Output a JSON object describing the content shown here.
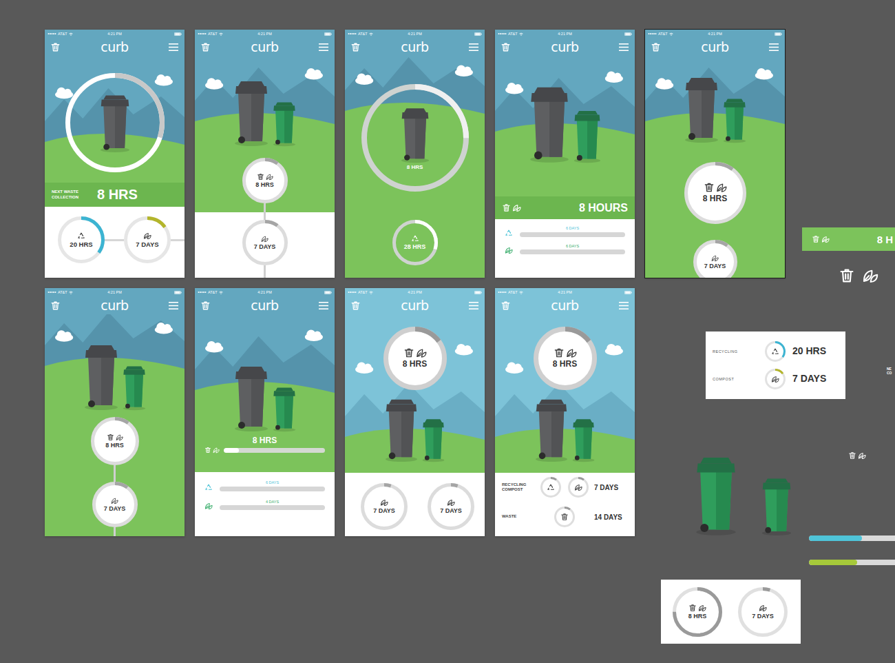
{
  "status_bar": {
    "carrier": "AT&T",
    "time": "4:21 PM"
  },
  "app_title": "curb",
  "screens": [
    {
      "kind": "hero",
      "selected": false,
      "ring_level": 0.3,
      "band": {
        "label": "NEXT WASTE COLLECTION",
        "reading": "8 HRS"
      },
      "gauges": [
        {
          "kind": "recycling",
          "reading": "20 HRS",
          "level": 0.35,
          "color": "#3cb4d2"
        },
        {
          "kind": "compost",
          "reading": "7 DAYS",
          "level": 0.15,
          "color": "#b3b52b"
        }
      ]
    },
    {
      "kind": "timeline-split",
      "selected": false,
      "connected": true,
      "nodes": [
        {
          "kind": "both",
          "reading": "8 HRS",
          "level": 0.1
        },
        {
          "kind": "compost",
          "reading": "7 DAYS",
          "level": 0.1
        }
      ]
    },
    {
      "kind": "ring-center",
      "selected": false,
      "ring": {
        "reading": "8 HRS",
        "level": 0.25
      },
      "next": {
        "kind": "recycling",
        "reading": "28 HRS",
        "level": 0.3
      }
    },
    {
      "kind": "bar-list",
      "selected": false,
      "band": {
        "kind": "both",
        "reading": "8 HOURS"
      },
      "bars": [
        {
          "kind": "recycling",
          "label": "6 DAYS",
          "level": 0.5,
          "color": "#4fc4d8"
        },
        {
          "kind": "compost",
          "label": "6 DAYS",
          "level": 0.45,
          "color": "#3aae6c"
        }
      ]
    },
    {
      "kind": "stack",
      "selected": true,
      "connected": false,
      "nodes": [
        {
          "kind": "both",
          "reading": "8 HRS",
          "level": 0.1
        },
        {
          "kind": "compost",
          "reading": "7 DAYS",
          "level": 0.1
        }
      ]
    },
    {
      "kind": "timeline",
      "selected": false,
      "connected": true,
      "nodes": [
        {
          "kind": "both",
          "reading": "8 HRS",
          "level": 0.1
        },
        {
          "kind": "compost",
          "reading": "7 DAYS",
          "level": 0.1
        }
      ]
    },
    {
      "kind": "bar-split",
      "selected": false,
      "main": {
        "kind": "both",
        "reading": "8 HRS",
        "level": 0.15
      },
      "bars": [
        {
          "kind": "recycling",
          "label": "6 DAYS",
          "level": 0.45,
          "color": "#4fc4d8"
        },
        {
          "kind": "compost",
          "label": "4 DAYS",
          "level": 0.45,
          "color": "#3aae6c"
        }
      ]
    },
    {
      "kind": "top-ring-circles",
      "selected": false,
      "ring": {
        "kind": "both",
        "reading": "8 HRS",
        "level": 0.15
      },
      "circles": [
        {
          "kind": "compost",
          "reading": "7 DAYS",
          "level": 0.05
        },
        {
          "kind": "compost",
          "reading": "7 DAYS",
          "level": 0.05
        }
      ]
    },
    {
      "kind": "top-ring-rows",
      "selected": false,
      "ring": {
        "kind": "both",
        "reading": "8 HRS",
        "level": 0.15
      },
      "rows": [
        {
          "label": "RECYCLING COMPOST",
          "icons": [
            {
              "kind": "recycling",
              "level": 0.1
            },
            {
              "kind": "compost",
              "level": 0.1
            }
          ],
          "reading": "7 DAYS"
        },
        {
          "label": "WASTE",
          "icons": [
            {
              "kind": "waste",
              "level": 0.1
            }
          ],
          "reading": "14 DAYS"
        }
      ]
    }
  ],
  "palette": {
    "band": {
      "kind": "both",
      "reading": "8 H"
    },
    "card": [
      {
        "label": "RECYCLING",
        "kind": "recycling",
        "reading": "20 HRS",
        "level": 0.35,
        "color": "#3cb4d2"
      },
      {
        "label": "COMPOST",
        "kind": "compost",
        "reading": "7 DAYS",
        "level": 0.15,
        "color": "#b3b52b"
      }
    ],
    "edge_label": [
      "NE",
      "CO"
    ],
    "bars": [
      {
        "level": 0.55,
        "color": "#4fc4d8"
      },
      {
        "level": 0.5,
        "color": "#a6c93a"
      }
    ],
    "gauges": [
      {
        "kind": "both",
        "reading": "8 HRS",
        "level": 0.75
      },
      {
        "kind": "compost",
        "reading": "7 DAYS",
        "level": 0.05
      }
    ]
  }
}
